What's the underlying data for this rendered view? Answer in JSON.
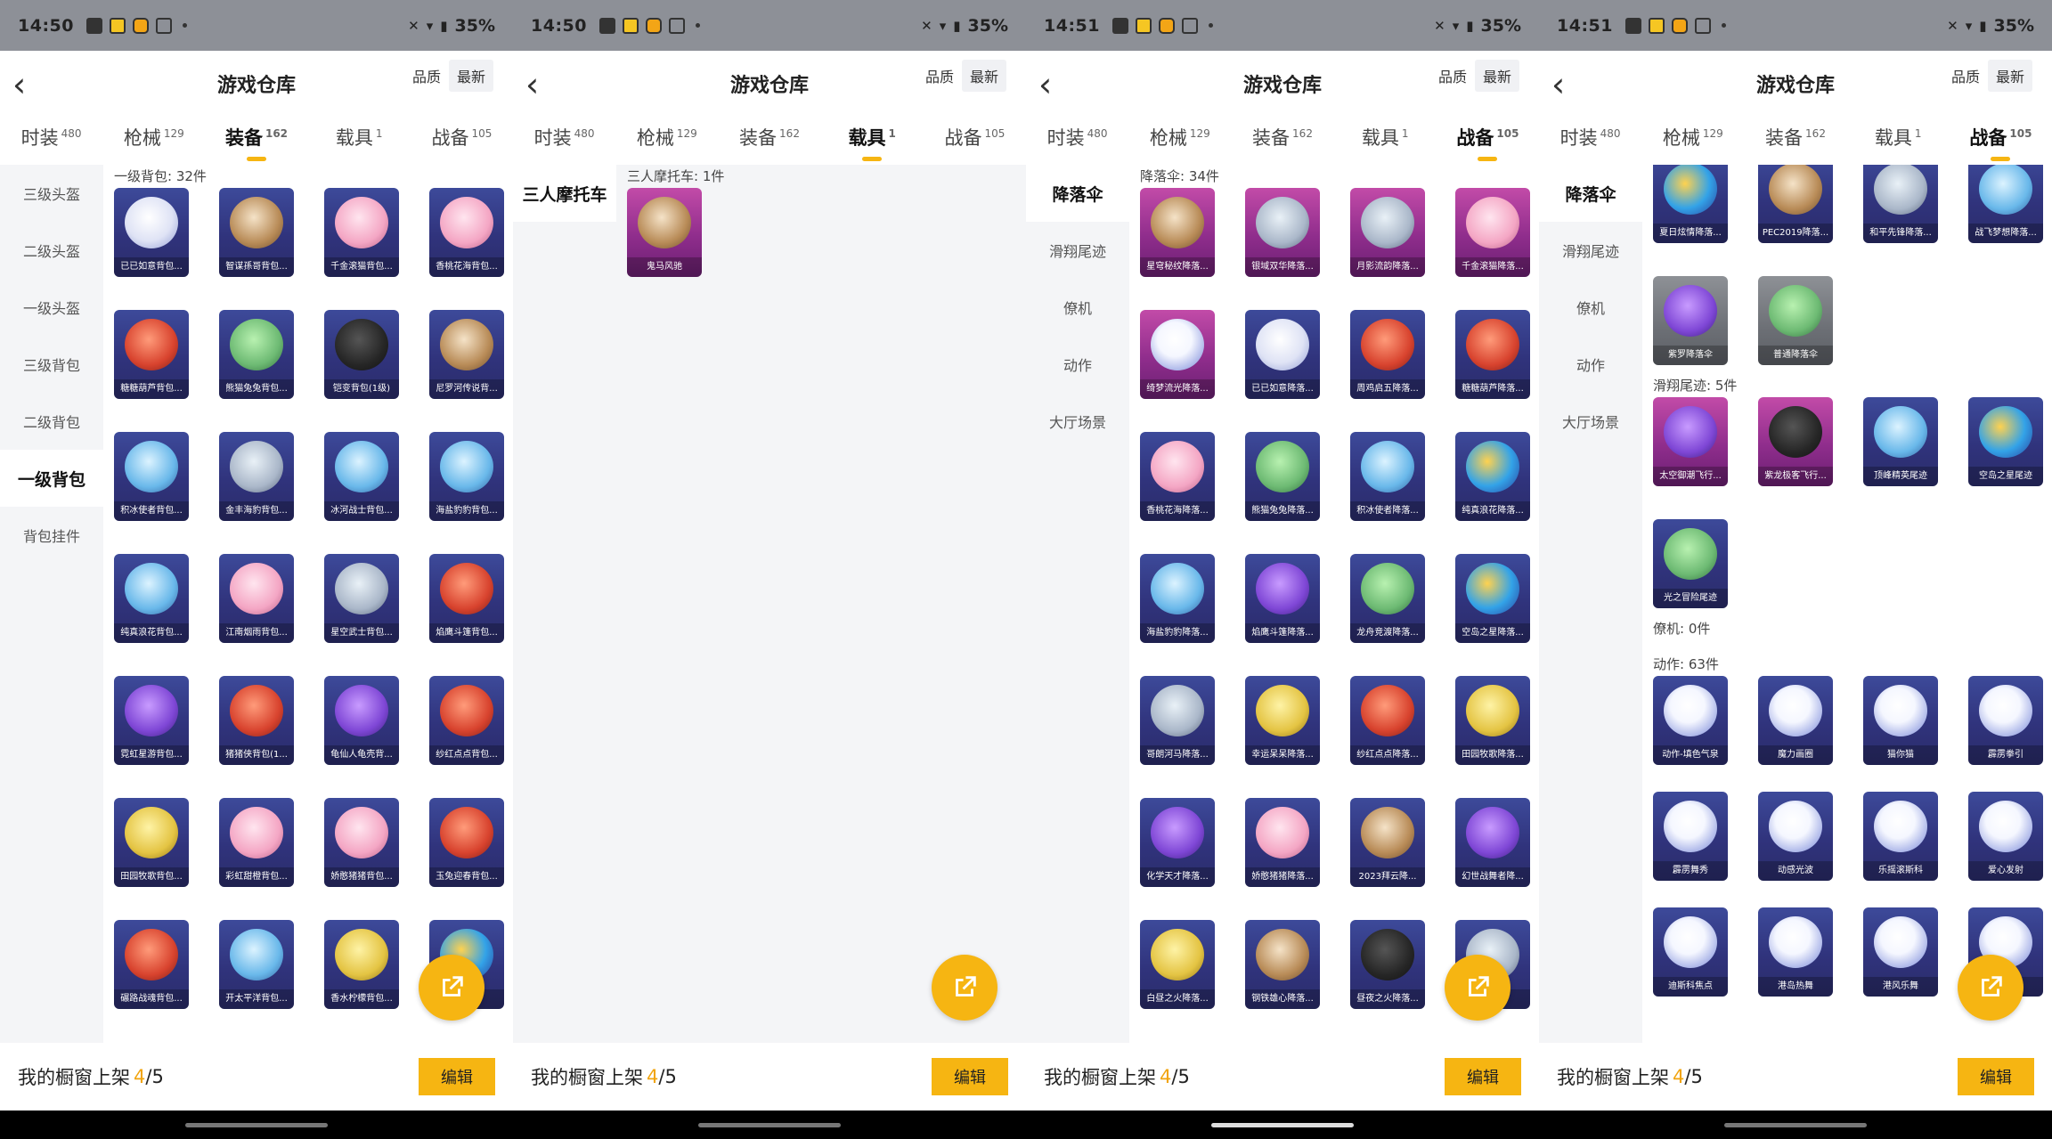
{
  "screens": [
    {
      "status": {
        "time": "14:50",
        "battery": "35%"
      },
      "title": "游戏仓库",
      "sort_quality": "品质",
      "sort_latest": "最新",
      "tabs": [
        {
          "label": "时装",
          "count": "480"
        },
        {
          "label": "枪械",
          "count": "129"
        },
        {
          "label": "装备",
          "count": "162"
        },
        {
          "label": "载具",
          "count": "1"
        },
        {
          "label": "战备",
          "count": "105"
        }
      ],
      "sidebar": [
        "三级头盔",
        "二级头盔",
        "一级头盔",
        "三级背包",
        "二级背包",
        "一级背包",
        "背包挂件"
      ],
      "sections": [
        {
          "label": "一级背包: 32件",
          "items": [
            "已已如意背包...",
            "智谋孫哥背包...",
            "千金滚猫背包...",
            "香桃花海背包...",
            "糖糖葫芦背包...",
            "熊猫兔兔背包...",
            "铠变背包(1级)",
            "尼罗河传说背...",
            "积冰使者背包...",
            "金丰海豹背包...",
            "冰河战士背包...",
            "海盐豹豹背包...",
            "纯真浪花背包...",
            "江南烟雨背包...",
            "星空武士背包...",
            "焰鹰斗篷背包...",
            "霓虹星游背包...",
            "猪猪侠背包(1...",
            "龟仙人龟壳背...",
            "纱红点点背包...",
            "田园牧歌背包...",
            "彩虹甜橙背包...",
            "娇憨猪猪背包...",
            "玉兔迎春背包...",
            "碾路战魂背包...",
            "开太平洋背包...",
            "香水柠檬背包...",
            ""
          ]
        }
      ],
      "bottom": {
        "label": "我的橱窗上架",
        "count": "4",
        "total": "/5",
        "edit": "编辑"
      }
    },
    {
      "status": {
        "time": "14:50",
        "battery": "35%"
      },
      "title": "游戏仓库",
      "sort_quality": "品质",
      "sort_latest": "最新",
      "tabs": [
        {
          "label": "时装",
          "count": "480"
        },
        {
          "label": "枪械",
          "count": "129"
        },
        {
          "label": "装备",
          "count": "162"
        },
        {
          "label": "载具",
          "count": "1"
        },
        {
          "label": "战备",
          "count": "105"
        }
      ],
      "sidebar": [
        "三人摩托车"
      ],
      "sections": [
        {
          "label": "三人摩托车: 1件",
          "items": [
            "鬼马风驰"
          ]
        }
      ],
      "bottom": {
        "label": "我的橱窗上架",
        "count": "4",
        "total": "/5",
        "edit": "编辑"
      }
    },
    {
      "status": {
        "time": "14:51",
        "battery": "35%"
      },
      "title": "游戏仓库",
      "sort_quality": "品质",
      "sort_latest": "最新",
      "tabs": [
        {
          "label": "时装",
          "count": "480"
        },
        {
          "label": "枪械",
          "count": "129"
        },
        {
          "label": "装备",
          "count": "162"
        },
        {
          "label": "载具",
          "count": "1"
        },
        {
          "label": "战备",
          "count": "105"
        }
      ],
      "sidebar": [
        "降落伞",
        "滑翔尾迹",
        "僚机",
        "动作",
        "大厅场景"
      ],
      "sections": [
        {
          "label": "降落伞: 34件",
          "items": [
            "星穹秘纹降落...",
            "银域双华降落...",
            "月影流韵降落...",
            "千金滚猫降落...",
            "绮梦流光降落...",
            "已已如意降落...",
            "周鸡启五降落...",
            "糖糖葫芦降落...",
            "香桃花海降落...",
            "熊猫兔兔降落...",
            "积冰使者降落...",
            "纯真浪花降落...",
            "海盐豹豹降落...",
            "焰鹰斗篷降落...",
            "龙舟竞渡降落...",
            "空岛之星降落...",
            "哥朗河马降落...",
            "幸运呆呆降落...",
            "纱红点点降落...",
            "田园牧歌降落...",
            "化学天才降落...",
            "娇憨猪猪降落...",
            "2023拜云降...",
            "幻世战舞者降...",
            "白昼之火降落...",
            "钢铁雄心降落...",
            "昼夜之火降落...",
            ""
          ]
        }
      ],
      "bottom": {
        "label": "我的橱窗上架",
        "count": "4",
        "total": "/5",
        "edit": "编辑"
      }
    },
    {
      "status": {
        "time": "14:51",
        "battery": "35%"
      },
      "title": "游戏仓库",
      "sort_quality": "品质",
      "sort_latest": "最新",
      "tabs": [
        {
          "label": "时装",
          "count": "480"
        },
        {
          "label": "枪械",
          "count": "129"
        },
        {
          "label": "装备",
          "count": "162"
        },
        {
          "label": "载具",
          "count": "1"
        },
        {
          "label": "战备",
          "count": "105"
        }
      ],
      "sidebar": [
        "降落伞",
        "滑翔尾迹",
        "僚机",
        "动作",
        "大厅场景"
      ],
      "sections": [
        {
          "label": "",
          "items": [
            "夏日炫情降落...",
            "PEC2019降落...",
            "和平先锋降落...",
            "战飞梦想降落...",
            "紫罗降落伞",
            "普通降落伞"
          ]
        },
        {
          "label": "滑翔尾迹: 5件",
          "items": [
            "太空御潮飞行...",
            "紫龙极客飞行...",
            "顶峰精英尾迹",
            "空岛之星尾迹",
            "光之冒险尾迹"
          ]
        },
        {
          "label": "僚机: 0件",
          "items": []
        },
        {
          "label": "动作: 63件",
          "items": [
            "动作-填色气泉",
            "魔力画圈",
            "猫你猫",
            "霹雳拳引",
            "霹雳舞秀",
            "动感光波",
            "乐摇滚斯科",
            "爱心发射",
            "迪斯科焦点",
            "港岛热舞",
            "港风乐舞",
            ""
          ]
        }
      ],
      "bottom": {
        "label": "我的橱窗上架",
        "count": "4",
        "total": "/5",
        "edit": "编辑"
      }
    }
  ]
}
